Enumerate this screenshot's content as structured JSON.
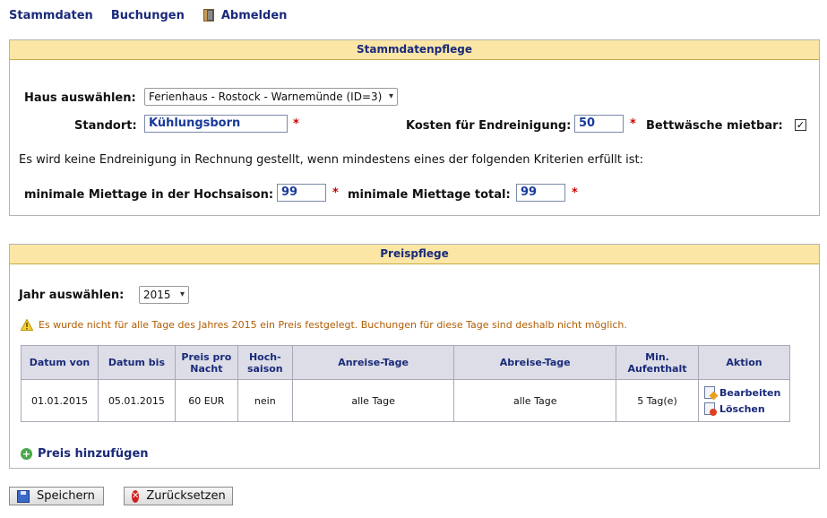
{
  "nav": {
    "stammdaten": "Stammdaten",
    "buchungen": "Buchungen",
    "abmelden": "Abmelden"
  },
  "stammdaten": {
    "title": "Stammdatenpflege",
    "haus_label": "Haus auswählen:",
    "haus_selected": "Ferienhaus - Rostock - Warnemünde (ID=3)",
    "standort_label": "Standort:",
    "standort_value": "Kühlungsborn",
    "kosten_label": "Kosten für Endreinigung:",
    "kosten_value": "50",
    "bettwaesche_label": "Bettwäsche mietbar:",
    "bettwaesche_checked": true,
    "info_text": "Es wird keine Endreinigung in Rechnung gestellt, wenn mindestens eines der folgenden Kriterien erfüllt ist:",
    "min_hochsaison_label": "minimale Miettage in der Hochsaison:",
    "min_hochsaison_value": "99",
    "min_total_label": "minimale Miettage total:",
    "min_total_value": "99",
    "required_mark": "*"
  },
  "preise": {
    "title": "Preispflege",
    "jahr_label": "Jahr auswählen:",
    "jahr_selected": "2015",
    "warning": "Es wurde nicht für alle Tage des Jahres 2015 ein Preis festgelegt. Buchungen für diese Tage sind deshalb nicht möglich.",
    "columns": [
      "Datum von",
      "Datum bis",
      "Preis pro Nacht",
      "Hoch-saison",
      "Anreise-Tage",
      "Abreise-Tage",
      "Min. Aufenthalt",
      "Aktion"
    ],
    "rows": [
      {
        "datum_von": "01.01.2015",
        "datum_bis": "05.01.2015",
        "preis": "60 EUR",
        "hochsaison": "nein",
        "anreise": "alle Tage",
        "abreise": "alle Tage",
        "aufenthalt": "5 Tag(e)",
        "edit_label": "Bearbeiten",
        "delete_label": "Löschen"
      }
    ],
    "add_label": "Preis hinzufügen"
  },
  "actions": {
    "save_label": "Speichern",
    "reset_label": "Zurücksetzen"
  },
  "colors": {
    "panel_header_bg": "#fbe6a6",
    "link": "#1a2a7a",
    "warning_text": "#b05c00",
    "required": "#d00000"
  },
  "icons": [
    "door-icon",
    "warning-icon",
    "edit-document-icon",
    "delete-document-icon",
    "add-icon",
    "floppy-disk-icon",
    "cancel-icon",
    "chevron-down-icon",
    "checkmark-icon"
  ]
}
